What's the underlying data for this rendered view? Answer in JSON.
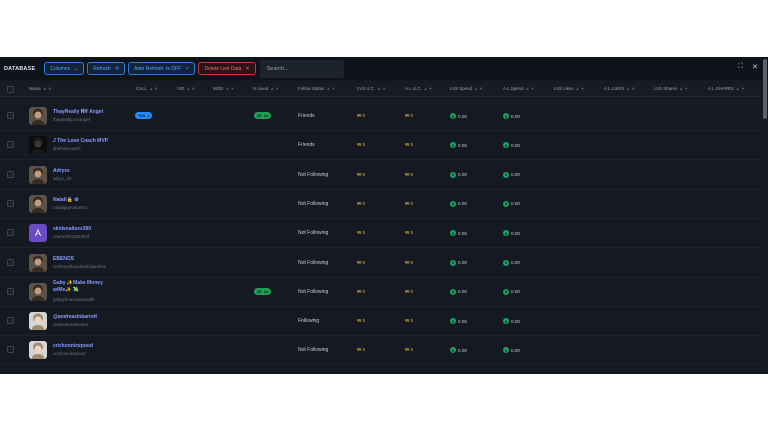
{
  "toolbar": {
    "title": "DATABASE",
    "columns_label": "Columns",
    "refresh_label": "Refresh",
    "auto_refresh_label": "Auto Refresh: Is OFF",
    "delete_label": "Delete Live Data",
    "search_placeholder": "Search..."
  },
  "columns": [
    "Name",
    "CALL",
    "VID",
    "MOD",
    "Is Lived",
    "Follow Status",
    "LVS U.C.",
    "A.L.U.C.",
    "LVS Spend",
    "A.L.Spend",
    "LVS Likes",
    "A.L.LIKES",
    "LVS Shares",
    "A.L.SHARES"
  ],
  "rows": [
    {
      "display": "ThayReally 𝐍𝐕 Angel",
      "username": "thayreally.nv.angel",
      "call": "TML 1",
      "lived": "GL 14",
      "status": "Friends",
      "lvs_uc": "0",
      "al_uc": "0",
      "lvs_spend": "0.00",
      "al_spend": "0.00",
      "avatar": "photo"
    },
    {
      "display": "J The Love Coach MVP",
      "username": "jthelovecoach",
      "call": "",
      "lived": "",
      "status": "Friends",
      "lvs_uc": "0",
      "al_uc": "0",
      "lvs_spend": "0.00",
      "al_spend": "0.00",
      "avatar": "dark"
    },
    {
      "display": "Adryzs",
      "username": "adryz_05",
      "call": "",
      "lived": "",
      "status": "Not Following",
      "lvs_uc": "0",
      "al_uc": "0",
      "lvs_spend": "0.00",
      "al_spend": "0.00",
      "avatar": "photo"
    },
    {
      "display": "Natali🔒 ⚙",
      "username": "nataliguevara001",
      "call": "",
      "lived": "",
      "status": "Not Following",
      "lvs_uc": "0",
      "al_uc": "0",
      "lvs_spend": "0.00",
      "al_spend": "0.00",
      "avatar": "photo"
    },
    {
      "display": "skidsnailsxx390",
      "username": "user10001550504",
      "call": "",
      "lived": "",
      "status": "Not Following",
      "lvs_uc": "0",
      "al_uc": "0",
      "lvs_spend": "0.00",
      "al_spend": "0.00",
      "avatar": "letter",
      "avatar_letter": "A"
    },
    {
      "display": "EBENOS",
      "username": "sashmythousandmijanniva",
      "call": "",
      "lived": "",
      "status": "Not Following",
      "lvs_uc": "0",
      "al_uc": "0",
      "lvs_spend": "0.00",
      "al_spend": "0.00",
      "avatar": "photo"
    },
    {
      "display": "Gaby ✨Make Money w/Me✨ 💸",
      "username": "gabyyfinancialwealth",
      "call": "",
      "lived": "GL 14",
      "status": "Not Following",
      "lvs_uc": "0",
      "al_uc": "0",
      "lvs_spend": "0.00",
      "al_spend": "0.00",
      "avatar": "photo"
    },
    {
      "display": "@andreazinbarrett",
      "username": "andreanmatsoren",
      "call": "",
      "lived": "",
      "status": "Following",
      "lvs_uc": "0",
      "al_uc": "0",
      "lvs_spend": "0.00",
      "al_spend": "0.00",
      "avatar": "photo-light"
    },
    {
      "display": "crickonnicepood",
      "username": "crickonnicepood",
      "call": "",
      "lived": "",
      "status": "Not Following",
      "lvs_uc": "0",
      "al_uc": "0",
      "lvs_spend": "0.00",
      "al_spend": "0.00",
      "avatar": "photo-light"
    }
  ],
  "icons": {
    "columns": "chevron-down-icon",
    "refresh": "refresh-icon",
    "auto": "check-icon",
    "delete": "close-icon",
    "max": "maximize-icon",
    "close": "close-icon"
  },
  "colors": {
    "accent_blue": "#2a7fd8",
    "danger": "#c0393b",
    "link": "#8a9cff",
    "coin": "#e0b442",
    "money": "#1ba360"
  }
}
